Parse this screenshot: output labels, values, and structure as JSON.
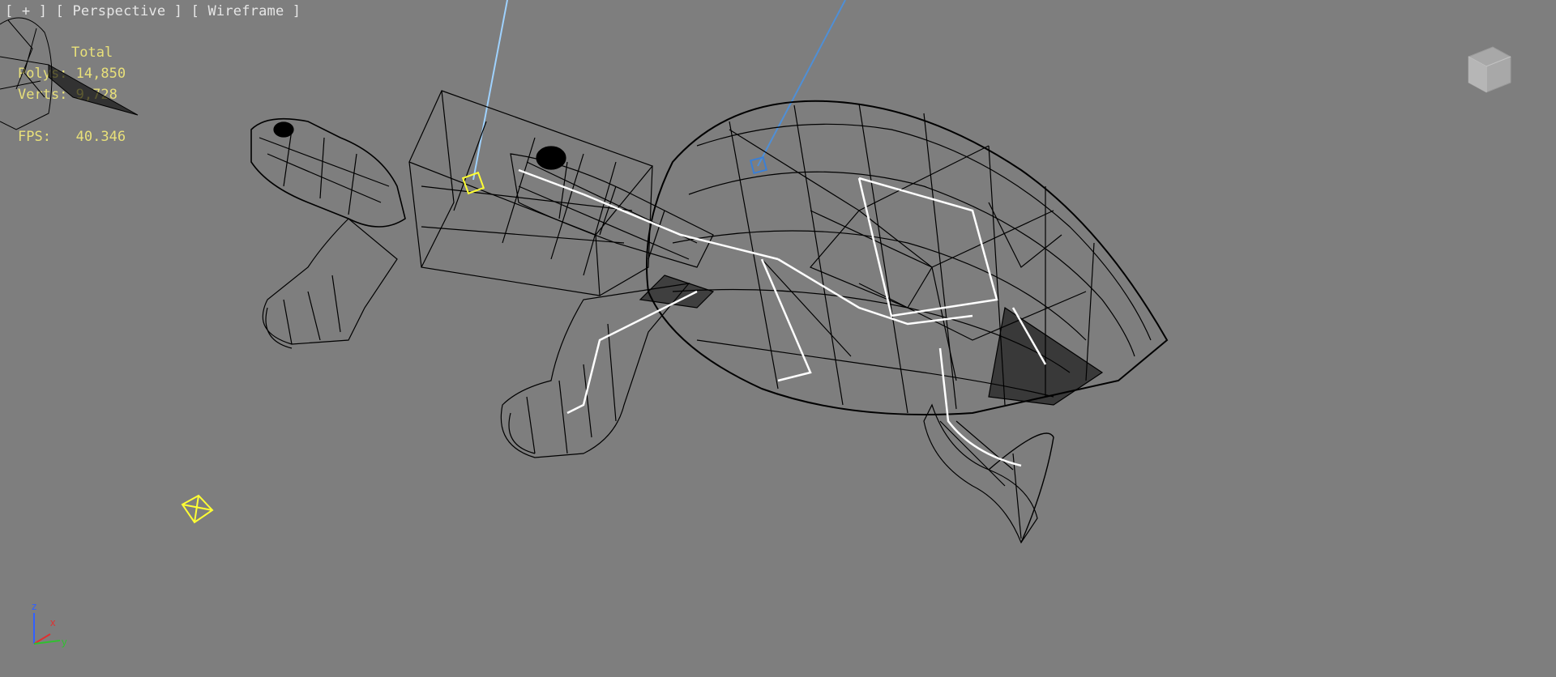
{
  "viewport": {
    "label_menu": "[ + ]",
    "label_view": "[ Perspective ]",
    "label_shading": "[ Wireframe ]"
  },
  "statistics": {
    "total_header": "Total",
    "polys_label": "Polys:",
    "polys_value": "14,850",
    "verts_label": "Verts:",
    "verts_value": "9,728",
    "fps_label": "FPS:",
    "fps_value": "40.346"
  },
  "gizmo_axes": {
    "z": "z",
    "x": "x",
    "y": "y"
  },
  "colors": {
    "background": "#7e7e7e",
    "wireframe": "#000000",
    "bones": "#ffffff",
    "helpers": "#ffff33",
    "stats_text": "#e8e07a",
    "light_line": "#9fd2ff",
    "light_line_alt": "#4f8fd6",
    "axis_x": "#e03030",
    "axis_y": "#30c030",
    "axis_z": "#3060ff"
  },
  "icons": [
    "viewcube-icon",
    "axis-tripod-icon",
    "light-target-icon",
    "camera-helper-icon"
  ]
}
